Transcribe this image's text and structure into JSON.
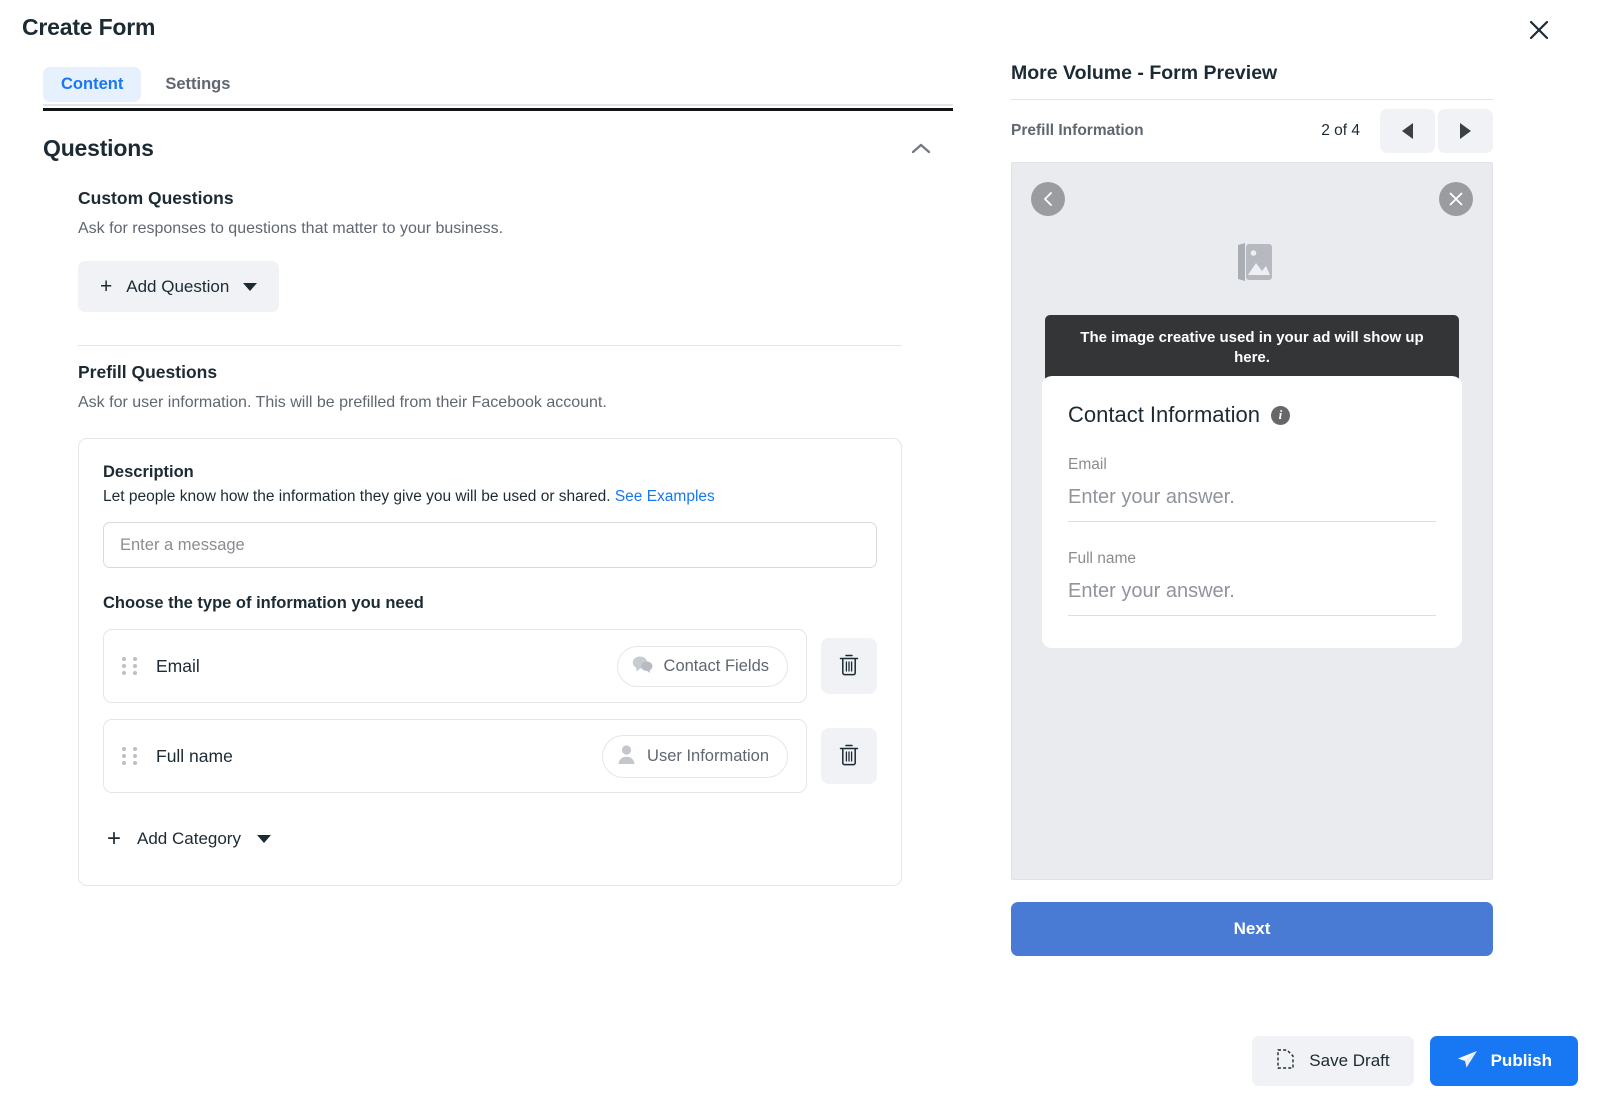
{
  "dialog": {
    "title": "Create Form",
    "close_icon": "close-icon"
  },
  "tabs": [
    {
      "label": "Content",
      "active": true
    },
    {
      "label": "Settings",
      "active": false
    }
  ],
  "questions_section": {
    "heading": "Questions",
    "collapse_icon": "chevron-up-icon",
    "custom": {
      "heading": "Custom Questions",
      "description": "Ask for responses to questions that matter to your business.",
      "add_button": "Add Question"
    },
    "prefill": {
      "heading": "Prefill Questions",
      "description": "Ask for user information. This will be prefilled from their Facebook account.",
      "card": {
        "description_label": "Description",
        "description_hint": "Let people know how the information they give you will be used or shared.",
        "see_examples_link": "See Examples",
        "message_placeholder": "Enter a message",
        "message_value": "",
        "choose_label": "Choose the type of information you need",
        "fields": [
          {
            "name": "Email",
            "badge": "Contact Fields",
            "badge_icon": "chat-bubbles-icon",
            "delete_icon": "trash-icon"
          },
          {
            "name": "Full name",
            "badge": "User Information",
            "badge_icon": "person-icon",
            "delete_icon": "trash-icon"
          }
        ],
        "add_category": "Add Category"
      }
    }
  },
  "preview": {
    "title": "More Volume - Form Preview",
    "step_label": "Prefill Information",
    "step_count": "2 of 4",
    "prev_icon": "triangle-left-icon",
    "next_icon": "triangle-right-icon",
    "phone": {
      "back_icon": "chevron-left-circle-icon",
      "close_icon": "close-circle-icon",
      "image_placeholder_icon": "image-stack-icon",
      "tooltip": "The image creative used in your ad will show up here.",
      "card_title": "Contact Information",
      "card_info_icon": "info-icon",
      "fields": [
        {
          "label": "Email",
          "placeholder": "Enter your answer."
        },
        {
          "label": "Full name",
          "placeholder": "Enter your answer."
        }
      ]
    },
    "next_button": "Next"
  },
  "footer": {
    "save_draft": "Save Draft",
    "save_draft_icon": "document-dashed-icon",
    "publish": "Publish",
    "publish_icon": "send-plane-icon"
  },
  "colors": {
    "accent_blue": "#1877f2",
    "tab_active_bg": "#e7f0fd",
    "next_button_blue": "#4a7bd4",
    "neutral_bg": "#f0f2f5",
    "tooltip_bg": "#333537",
    "phone_bg": "#eaebef"
  }
}
